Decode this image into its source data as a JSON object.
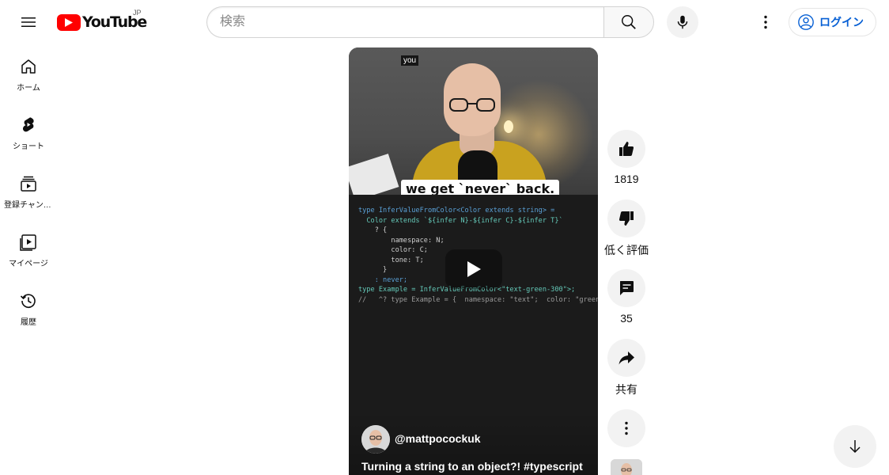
{
  "masthead": {
    "logo_text": "YouTube",
    "region": "JP",
    "search": {
      "placeholder": "検索",
      "value": ""
    },
    "login_label": "ログイン",
    "icons": [
      "menu-icon",
      "youtube-logo",
      "search-icon",
      "microphone-icon",
      "more-vert-icon",
      "account-circle-icon"
    ]
  },
  "guide": {
    "items": [
      {
        "label": "ホーム",
        "icon": "home-icon"
      },
      {
        "label": "ショート",
        "icon": "shorts-icon"
      },
      {
        "label": "登録チャンネル",
        "icon": "subscriptions-icon"
      },
      {
        "label": "マイページ",
        "icon": "library-icon"
      },
      {
        "label": "履歴",
        "icon": "history-icon"
      }
    ]
  },
  "short": {
    "caption_small": "you",
    "caption_main": "we get `never` back.",
    "code_lines": [
      "type InferValueFromColor<Color extends string> =",
      "  Color extends `${infer N}-${infer C}-${infer T}`",
      "    ? {",
      "        namespace: N;",
      "        color: C;",
      "        tone: T;",
      "      }",
      "    : never;",
      "",
      "type Example = InferValueFromColor<\"text-green-300\">;",
      "//   ^? type Example = {  namespace: \"text\";  color: \"green\""
    ],
    "channel": "@mattpocockuk",
    "title": "Turning a string to an object?! #typescript"
  },
  "actions": {
    "like_count": "1819",
    "dislike_label": "低く評価",
    "comment_count": "35",
    "share_label": "共有"
  },
  "colors": {
    "brand_red": "#ff0000",
    "link_blue": "#065fd4",
    "button_bg": "#f2f2f2"
  }
}
